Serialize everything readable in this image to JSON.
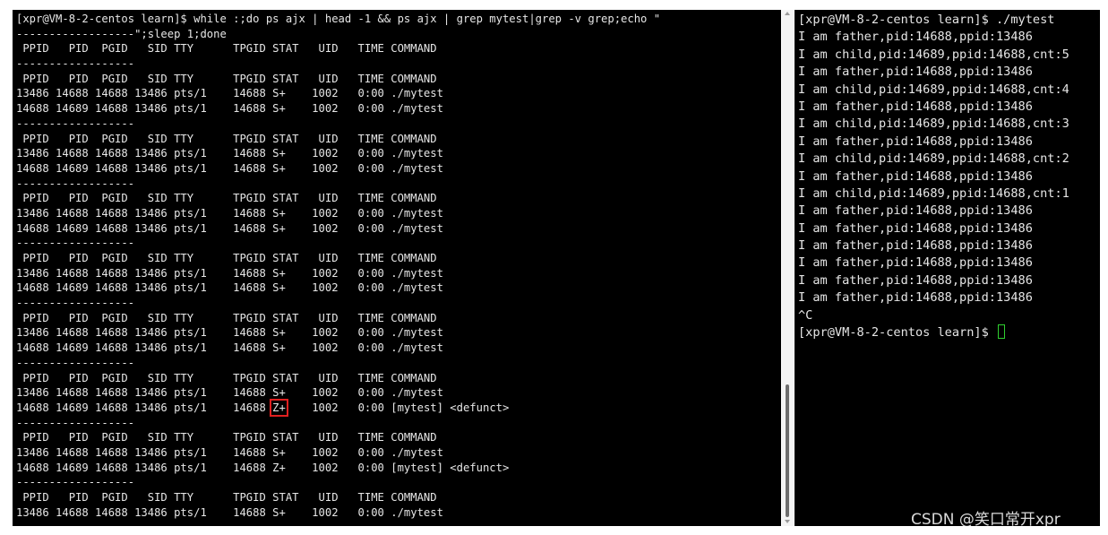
{
  "left_terminal": {
    "lines": [
      "[xpr@VM-8-2-centos learn]$ while :;do ps ajx | head -1 && ps ajx | grep mytest|grep -v grep;echo \"",
      "------------------\";sleep 1;done",
      " PPID   PID  PGID   SID TTY      TPGID STAT   UID   TIME COMMAND",
      "------------------",
      " PPID   PID  PGID   SID TTY      TPGID STAT   UID   TIME COMMAND",
      "13486 14688 14688 13486 pts/1    14688 S+    1002   0:00 ./mytest",
      "14688 14689 14688 13486 pts/1    14688 S+    1002   0:00 ./mytest",
      "------------------",
      " PPID   PID  PGID   SID TTY      TPGID STAT   UID   TIME COMMAND",
      "13486 14688 14688 13486 pts/1    14688 S+    1002   0:00 ./mytest",
      "14688 14689 14688 13486 pts/1    14688 S+    1002   0:00 ./mytest",
      "------------------",
      " PPID   PID  PGID   SID TTY      TPGID STAT   UID   TIME COMMAND",
      "13486 14688 14688 13486 pts/1    14688 S+    1002   0:00 ./mytest",
      "14688 14689 14688 13486 pts/1    14688 S+    1002   0:00 ./mytest",
      "------------------",
      " PPID   PID  PGID   SID TTY      TPGID STAT   UID   TIME COMMAND",
      "13486 14688 14688 13486 pts/1    14688 S+    1002   0:00 ./mytest",
      "14688 14689 14688 13486 pts/1    14688 S+    1002   0:00 ./mytest",
      "------------------",
      " PPID   PID  PGID   SID TTY      TPGID STAT   UID   TIME COMMAND",
      "13486 14688 14688 13486 pts/1    14688 S+    1002   0:00 ./mytest",
      "14688 14689 14688 13486 pts/1    14688 S+    1002   0:00 ./mytest",
      "------------------",
      " PPID   PID  PGID   SID TTY      TPGID STAT   UID   TIME COMMAND",
      "13486 14688 14688 13486 pts/1    14688 S+    1002   0:00 ./mytest",
      "14688 14689 14688 13486 pts/1    14688 Z+    1002   0:00 [mytest] <defunct>",
      "------------------",
      " PPID   PID  PGID   SID TTY      TPGID STAT   UID   TIME COMMAND",
      "13486 14688 14688 13486 pts/1    14688 S+    1002   0:00 ./mytest",
      "14688 14689 14688 13486 pts/1    14688 Z+    1002   0:00 [mytest] <defunct>",
      "------------------",
      " PPID   PID  PGID   SID TTY      TPGID STAT   UID   TIME COMMAND",
      "13486 14688 14688 13486 pts/1    14688 S+    1002   0:00 ./mytest"
    ]
  },
  "highlight": {
    "line_index": 26,
    "text_before": "14688 14689 14688 13486 pts/1    14688 ",
    "stat": "Z+",
    "text_after": "    1002   0:00 [mytest] <defunct>",
    "color": "#e02020"
  },
  "right_terminal": {
    "lines": [
      "[xpr@VM-8-2-centos learn]$ ./mytest",
      "I am father,pid:14688,ppid:13486",
      "I am child,pid:14689,ppid:14688,cnt:5",
      "I am father,pid:14688,ppid:13486",
      "I am child,pid:14689,ppid:14688,cnt:4",
      "I am father,pid:14688,ppid:13486",
      "I am child,pid:14689,ppid:14688,cnt:3",
      "I am father,pid:14688,ppid:13486",
      "I am child,pid:14689,ppid:14688,cnt:2",
      "I am father,pid:14688,ppid:13486",
      "I am child,pid:14689,ppid:14688,cnt:1",
      "I am father,pid:14688,ppid:13486",
      "I am father,pid:14688,ppid:13486",
      "I am father,pid:14688,ppid:13486",
      "I am father,pid:14688,ppid:13486",
      "I am father,pid:14688,ppid:13486",
      "I am father,pid:14688,ppid:13486",
      "^C"
    ],
    "prompt": "[xpr@VM-8-2-centos learn]$ ",
    "cursor_color": "#30d030"
  },
  "watermark": "CSDN @笑口常开xpr"
}
